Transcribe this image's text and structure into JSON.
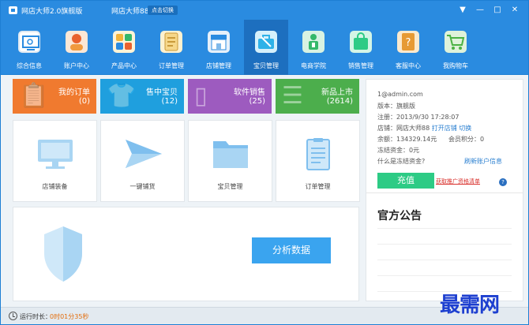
{
  "titlebar": {
    "app_name": "网店大师2.0旗舰版",
    "store_name": "网店大师88",
    "switch_label": "点击切换",
    "controls": [
      "▼",
      "—",
      "□",
      "✕"
    ]
  },
  "toolbar": {
    "items": [
      {
        "label": "综合信息",
        "icon": "monitor-search-icon",
        "color": "#ffffff"
      },
      {
        "label": "账户中心",
        "icon": "person-icon",
        "color": "#e9622e"
      },
      {
        "label": "产品中心",
        "icon": "apps-icon",
        "color": "#f3b339"
      },
      {
        "label": "订单管理",
        "icon": "order-list-icon",
        "color": "#f6d789"
      },
      {
        "label": "店铺管理",
        "icon": "storefront-icon",
        "color": "#e6f0fa"
      },
      {
        "label": "宝贝管理",
        "icon": "tools-briefcase-icon",
        "color": "#2fb2e8",
        "active": true
      },
      {
        "label": "电商学院",
        "icon": "teacher-icon",
        "color": "#35b86a"
      },
      {
        "label": "销售管理",
        "icon": "shopping-bag-icon",
        "color": "#2dcb85"
      },
      {
        "label": "客服中心",
        "icon": "book-question-icon",
        "color": "#e69a35"
      },
      {
        "label": "我购物车",
        "icon": "shopping-cart-icon",
        "color": "#4bb244"
      }
    ]
  },
  "tiles": [
    {
      "title": "我的订单",
      "count": "(0)",
      "color": "#f07a2f",
      "icon": "clipboard-icon"
    },
    {
      "title": "售中宝贝",
      "count": "(12)",
      "color": "#1f9fde",
      "icon": "tshirt-icon"
    },
    {
      "title": "软件销售",
      "count": "(25)",
      "color": "#9d5bbf",
      "icon": "phone-icon"
    },
    {
      "title": "新品上市",
      "count": "(2614)",
      "color": "#4cae4c",
      "icon": "new-list-icon"
    }
  ],
  "cards": [
    {
      "label": "店铺装备",
      "icon": "monitor-icon"
    },
    {
      "label": "一键铺货",
      "icon": "paper-plane-icon"
    },
    {
      "label": "宝贝管理",
      "icon": "folder-icon"
    },
    {
      "label": "订单管理",
      "icon": "document-icon"
    }
  ],
  "analyze_button": "分析数据",
  "account": {
    "email": "1@admin.com",
    "version": "版本：旗舰版",
    "register": "注册：2013/9/30 17:28:07",
    "store_label": "店铺：网店大师88",
    "open_store": "打开店铺",
    "switch": "切换",
    "balance": "余额：134329.14元",
    "points": "会员积分：0",
    "frozen": "冻结资金：0元",
    "what_frozen": "什么是冻结资金?",
    "refresh": "刷新账户信息",
    "recharge": "充值",
    "promo": "获取推广资格清单",
    "help": "?"
  },
  "notice_title": "官方公告",
  "status": {
    "label": "运行时长：",
    "value": "0时01分35秒"
  },
  "watermark": "最需网"
}
